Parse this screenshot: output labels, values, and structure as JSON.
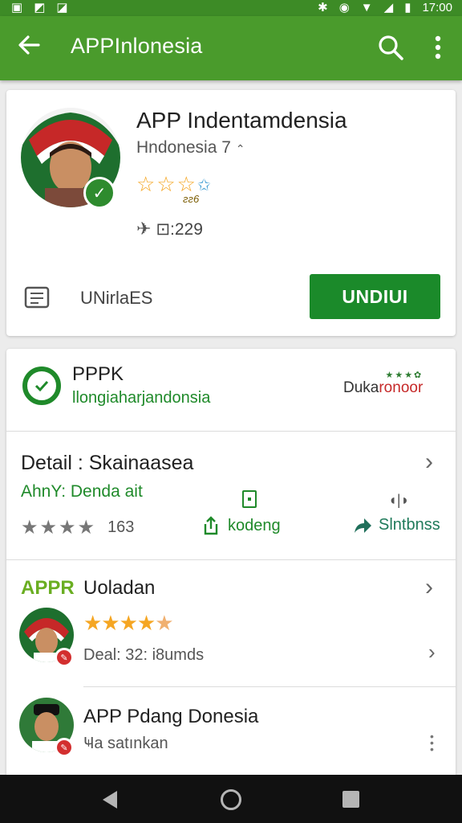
{
  "status_bar": {
    "time": "17:00"
  },
  "app_bar": {
    "title": "APPInlonesia"
  },
  "app_card": {
    "title": "APP Indentamdensia",
    "subtitle": "Hndonesia 7",
    "stars_label": "ƨƨ6",
    "downloads": "⊡:229",
    "secondary_label": "UNirlaES",
    "install_label": "UNDIUI"
  },
  "developer": {
    "name": "PPPK",
    "subtitle": "llongiaharjandonsia",
    "brand_dark": "Duka",
    "brand_red": "ronoor",
    "brand_dots": "★★★✿"
  },
  "details": {
    "title": "Detail : Skainaasea",
    "subtitle": "AhnY: Denda ait",
    "rating_count": "163",
    "action1_label": "kodeng",
    "action2_label": "Slntbnss"
  },
  "section": {
    "tag": "APPR",
    "title": "Uoladan",
    "deal_text": "Deal: 32: i8umds"
  },
  "item": {
    "title": "APP Pdang Donesia",
    "subtitle": "Ҹa satınkan"
  },
  "colors": {
    "brand_green": "#4a9b2c",
    "install_green": "#1b8a2a",
    "star_orange": "#f5a623"
  }
}
